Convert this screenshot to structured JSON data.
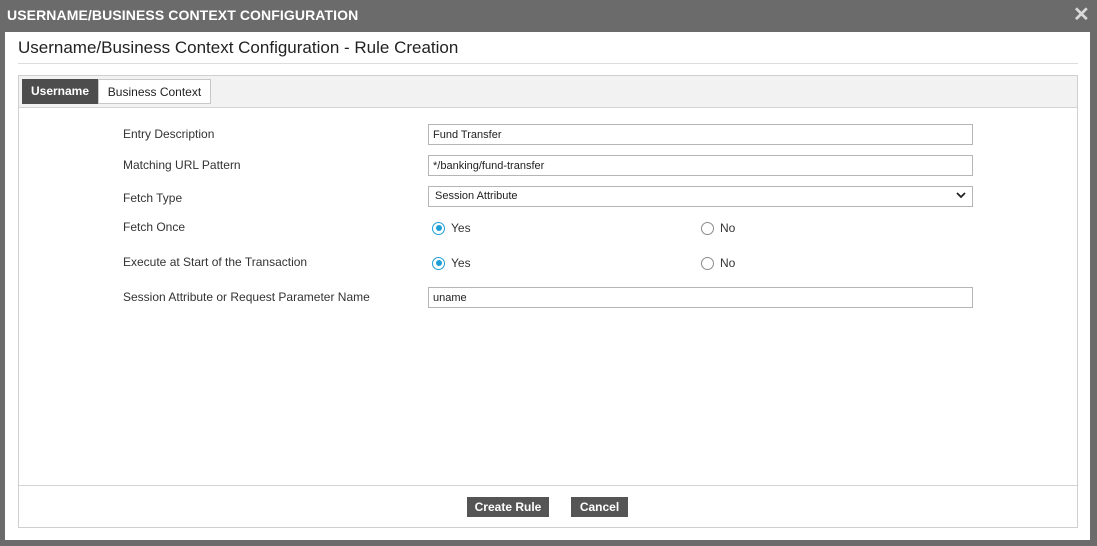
{
  "window": {
    "title": "USERNAME/BUSINESS CONTEXT CONFIGURATION",
    "close_icon": "close-icon"
  },
  "page": {
    "heading": "Username/Business Context Configuration - Rule Creation"
  },
  "tabs": [
    {
      "label": "Username",
      "active": true
    },
    {
      "label": "Business Context",
      "active": false
    }
  ],
  "form": {
    "entry_description": {
      "label": "Entry Description",
      "value": "Fund Transfer"
    },
    "matching_url_pattern": {
      "label": "Matching URL Pattern",
      "value": "*/banking/fund-transfer"
    },
    "fetch_type": {
      "label": "Fetch Type",
      "selected": "Session Attribute"
    },
    "fetch_once": {
      "label": "Fetch Once",
      "options": [
        "Yes",
        "No"
      ],
      "selected": "Yes"
    },
    "execute_at_start": {
      "label": "Execute at Start of the Transaction",
      "options": [
        "Yes",
        "No"
      ],
      "selected": "Yes"
    },
    "param_name": {
      "label": "Session Attribute or Request Parameter Name",
      "value": "uname"
    }
  },
  "buttons": {
    "create": "Create Rule",
    "cancel": "Cancel"
  },
  "colors": {
    "accent": "#1e9fd6",
    "titlebar": "#6b6b6b",
    "button": "#555555",
    "active_tab": "#4d4d4d"
  }
}
